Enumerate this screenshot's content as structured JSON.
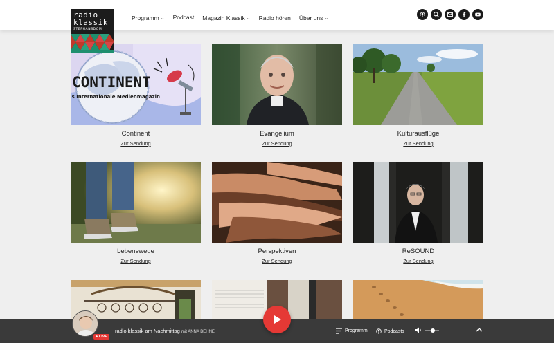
{
  "logo": {
    "line1": "radio",
    "line2": "klassik",
    "line3": "STEPHANSDOM"
  },
  "nav": {
    "items": [
      {
        "label": "Programm",
        "dropdown": true,
        "active": false
      },
      {
        "label": "Podcast",
        "dropdown": false,
        "active": true
      },
      {
        "label": "Magazin Klassik",
        "dropdown": true,
        "active": false
      },
      {
        "label": "Radio hören",
        "dropdown": false,
        "active": false
      },
      {
        "label": "Über uns",
        "dropdown": true,
        "active": false
      }
    ],
    "dropdown_glyph": "⌄"
  },
  "social_icons": [
    "podcast-icon",
    "search-icon",
    "mail-icon",
    "facebook-icon",
    "youtube-icon"
  ],
  "podcasts": [
    {
      "title": "Continent",
      "link": "Zur Sendung",
      "thumb_text": "CONTINENT",
      "thumb_subtext": "Das Internationale Medienmagazin"
    },
    {
      "title": "Evangelium",
      "link": "Zur Sendung"
    },
    {
      "title": "Kulturausflüge",
      "link": "Zur Sendung"
    },
    {
      "title": "Lebenswege",
      "link": "Zur Sendung"
    },
    {
      "title": "Perspektiven",
      "link": "Zur Sendung"
    },
    {
      "title": "ReSOUND",
      "link": "Zur Sendung"
    }
  ],
  "player": {
    "live_label": "LIVE",
    "track_title": "radio klassik am Nachmittag",
    "track_with": "mit ANNA BEHNE",
    "programm_label": "Programm",
    "podcasts_label": "Podcasts",
    "accent_color": "#e53935"
  }
}
